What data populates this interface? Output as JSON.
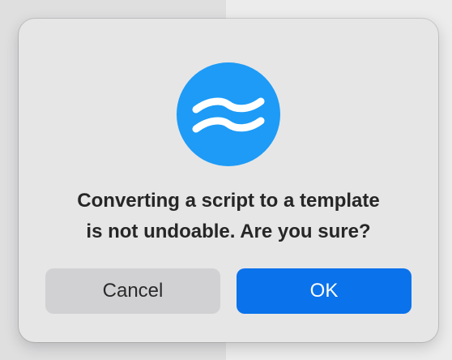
{
  "dialog": {
    "icon": "waves-app-icon",
    "message_line1": "Converting a script to a template",
    "message_line2": "is not undoable. Are you sure?",
    "cancel_label": "Cancel",
    "ok_label": "OK"
  },
  "colors": {
    "icon_background": "#1d9bf6",
    "ok_button": "#0a72eb",
    "cancel_button": "#d1d1d3"
  }
}
